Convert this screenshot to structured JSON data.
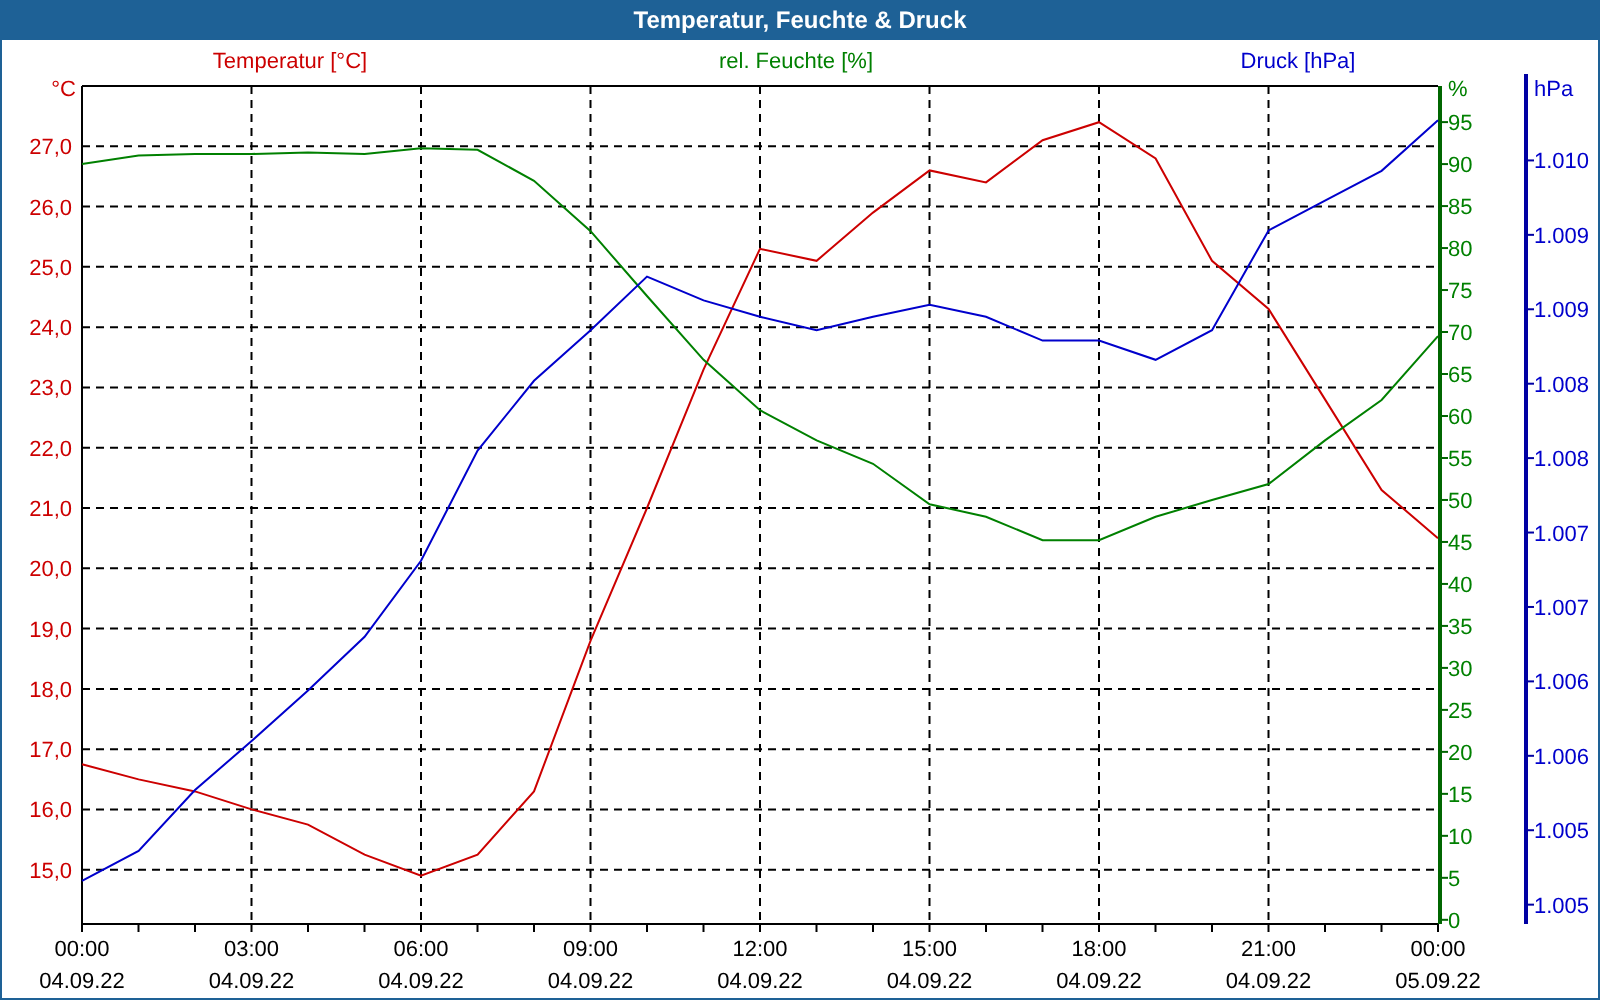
{
  "window": {
    "title": "Temperatur, Feuchte & Druck"
  },
  "chart": {
    "chart_data": {
      "type": "line",
      "grid": true,
      "ylabel": "°C",
      "y2label": "%",
      "y3label": "hPa",
      "categories": [
        "00:00 04.09.22",
        null,
        null,
        "03:00 04.09.22",
        null,
        null,
        "06:00 04.09.22",
        null,
        null,
        "09:00 04.09.22",
        null,
        null,
        "12:00 04.09.22",
        null,
        null,
        "15:00 04.09.22",
        null,
        null,
        "18:00 04.09.22",
        null,
        null,
        "21:00 04.09.22",
        null,
        null,
        "00:00 05.09.22"
      ],
      "ylim": [
        14.1,
        28.0
      ],
      "yticks": [
        {
          "value": 27,
          "label": "27,0"
        },
        {
          "value": 26,
          "label": "26,0"
        },
        {
          "value": 25,
          "label": "25,0"
        },
        {
          "value": 24,
          "label": "24,0"
        },
        {
          "value": 23,
          "label": "23,0"
        },
        {
          "value": 22,
          "label": "22,0"
        },
        {
          "value": 21,
          "label": "21,0"
        },
        {
          "value": 20,
          "label": "20,0"
        },
        {
          "value": 19,
          "label": "19,0"
        },
        {
          "value": 18,
          "label": "18,0"
        },
        {
          "value": 17,
          "label": "17,0"
        },
        {
          "value": 16,
          "label": "16,0"
        },
        {
          "value": 15,
          "label": "15,0"
        }
      ],
      "y2lim": [
        -0.5,
        99.3
      ],
      "y2ticks": [
        95,
        90,
        85,
        80,
        75,
        70,
        65,
        60,
        55,
        50,
        45,
        40,
        35,
        30,
        25,
        20,
        15,
        10,
        5,
        0
      ],
      "y3lim": [
        1004.67,
        1010.3
      ],
      "y3ticks": [
        {
          "value": 1009.8,
          "label": "1.010"
        },
        {
          "value": 1009.3,
          "label": "1.009"
        },
        {
          "value": 1008.8,
          "label": "1.009"
        },
        {
          "value": 1008.3,
          "label": "1.008"
        },
        {
          "value": 1007.8,
          "label": "1.008"
        },
        {
          "value": 1007.3,
          "label": "1.007"
        },
        {
          "value": 1006.8,
          "label": "1.007"
        },
        {
          "value": 1006.3,
          "label": "1.006"
        },
        {
          "value": 1005.8,
          "label": "1.006"
        },
        {
          "value": 1005.3,
          "label": "1.005"
        },
        {
          "value": 1004.8,
          "label": "1.005"
        }
      ],
      "series": [
        {
          "name": "Temperatur [°C]",
          "color": "#cc0000",
          "values": [
            16.75,
            16.5,
            16.3,
            16.0,
            15.75,
            15.25,
            14.9,
            15.25,
            16.3,
            18.8,
            21.0,
            23.3,
            25.3,
            25.1,
            25.9,
            26.6,
            26.4,
            27.1,
            27.4,
            26.8,
            25.1,
            24.3,
            22.8,
            21.3,
            20.5
          ]
        },
        {
          "name": "rel. Feuchte [%]",
          "color": "#008000",
          "axis": "y2",
          "values": [
            90,
            91,
            91.2,
            91.2,
            91.4,
            91.2,
            91.9,
            91.7,
            88,
            82,
            74.3,
            66.7,
            60.7,
            57.1,
            54.3,
            49.5,
            48,
            45.2,
            45.2,
            48,
            50,
            51.9,
            57.1,
            61.9,
            69.5
          ]
        },
        {
          "name": "Druck [hPa]",
          "color": "#0000cc",
          "axis": "y3",
          "values": [
            1004.96,
            1005.16,
            1005.57,
            1005.9,
            1006.24,
            1006.6,
            1007.11,
            1007.85,
            1008.32,
            1008.66,
            1009.02,
            1008.86,
            1008.75,
            1008.66,
            1008.75,
            1008.83,
            1008.75,
            1008.59,
            1008.59,
            1008.46,
            1008.66,
            1009.33,
            1009.53,
            1009.73,
            1010.07
          ]
        }
      ]
    }
  }
}
